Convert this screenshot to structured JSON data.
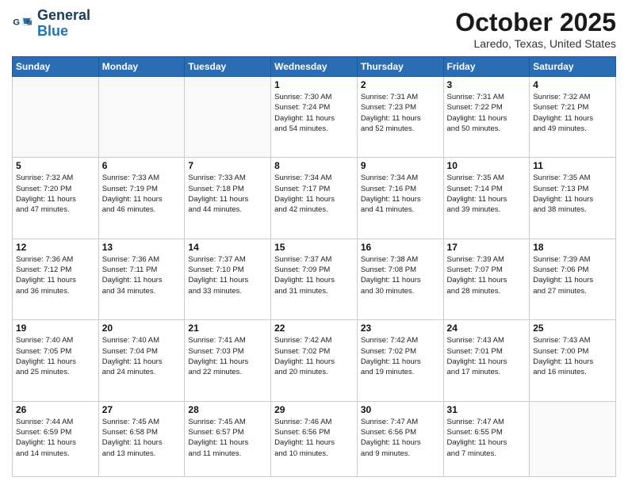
{
  "header": {
    "logo_line1": "General",
    "logo_line2": "Blue",
    "month": "October 2025",
    "location": "Laredo, Texas, United States"
  },
  "weekdays": [
    "Sunday",
    "Monday",
    "Tuesday",
    "Wednesday",
    "Thursday",
    "Friday",
    "Saturday"
  ],
  "weeks": [
    [
      {
        "day": "",
        "info": ""
      },
      {
        "day": "",
        "info": ""
      },
      {
        "day": "",
        "info": ""
      },
      {
        "day": "1",
        "info": "Sunrise: 7:30 AM\nSunset: 7:24 PM\nDaylight: 11 hours\nand 54 minutes."
      },
      {
        "day": "2",
        "info": "Sunrise: 7:31 AM\nSunset: 7:23 PM\nDaylight: 11 hours\nand 52 minutes."
      },
      {
        "day": "3",
        "info": "Sunrise: 7:31 AM\nSunset: 7:22 PM\nDaylight: 11 hours\nand 50 minutes."
      },
      {
        "day": "4",
        "info": "Sunrise: 7:32 AM\nSunset: 7:21 PM\nDaylight: 11 hours\nand 49 minutes."
      }
    ],
    [
      {
        "day": "5",
        "info": "Sunrise: 7:32 AM\nSunset: 7:20 PM\nDaylight: 11 hours\nand 47 minutes."
      },
      {
        "day": "6",
        "info": "Sunrise: 7:33 AM\nSunset: 7:19 PM\nDaylight: 11 hours\nand 46 minutes."
      },
      {
        "day": "7",
        "info": "Sunrise: 7:33 AM\nSunset: 7:18 PM\nDaylight: 11 hours\nand 44 minutes."
      },
      {
        "day": "8",
        "info": "Sunrise: 7:34 AM\nSunset: 7:17 PM\nDaylight: 11 hours\nand 42 minutes."
      },
      {
        "day": "9",
        "info": "Sunrise: 7:34 AM\nSunset: 7:16 PM\nDaylight: 11 hours\nand 41 minutes."
      },
      {
        "day": "10",
        "info": "Sunrise: 7:35 AM\nSunset: 7:14 PM\nDaylight: 11 hours\nand 39 minutes."
      },
      {
        "day": "11",
        "info": "Sunrise: 7:35 AM\nSunset: 7:13 PM\nDaylight: 11 hours\nand 38 minutes."
      }
    ],
    [
      {
        "day": "12",
        "info": "Sunrise: 7:36 AM\nSunset: 7:12 PM\nDaylight: 11 hours\nand 36 minutes."
      },
      {
        "day": "13",
        "info": "Sunrise: 7:36 AM\nSunset: 7:11 PM\nDaylight: 11 hours\nand 34 minutes."
      },
      {
        "day": "14",
        "info": "Sunrise: 7:37 AM\nSunset: 7:10 PM\nDaylight: 11 hours\nand 33 minutes."
      },
      {
        "day": "15",
        "info": "Sunrise: 7:37 AM\nSunset: 7:09 PM\nDaylight: 11 hours\nand 31 minutes."
      },
      {
        "day": "16",
        "info": "Sunrise: 7:38 AM\nSunset: 7:08 PM\nDaylight: 11 hours\nand 30 minutes."
      },
      {
        "day": "17",
        "info": "Sunrise: 7:39 AM\nSunset: 7:07 PM\nDaylight: 11 hours\nand 28 minutes."
      },
      {
        "day": "18",
        "info": "Sunrise: 7:39 AM\nSunset: 7:06 PM\nDaylight: 11 hours\nand 27 minutes."
      }
    ],
    [
      {
        "day": "19",
        "info": "Sunrise: 7:40 AM\nSunset: 7:05 PM\nDaylight: 11 hours\nand 25 minutes."
      },
      {
        "day": "20",
        "info": "Sunrise: 7:40 AM\nSunset: 7:04 PM\nDaylight: 11 hours\nand 24 minutes."
      },
      {
        "day": "21",
        "info": "Sunrise: 7:41 AM\nSunset: 7:03 PM\nDaylight: 11 hours\nand 22 minutes."
      },
      {
        "day": "22",
        "info": "Sunrise: 7:42 AM\nSunset: 7:02 PM\nDaylight: 11 hours\nand 20 minutes."
      },
      {
        "day": "23",
        "info": "Sunrise: 7:42 AM\nSunset: 7:02 PM\nDaylight: 11 hours\nand 19 minutes."
      },
      {
        "day": "24",
        "info": "Sunrise: 7:43 AM\nSunset: 7:01 PM\nDaylight: 11 hours\nand 17 minutes."
      },
      {
        "day": "25",
        "info": "Sunrise: 7:43 AM\nSunset: 7:00 PM\nDaylight: 11 hours\nand 16 minutes."
      }
    ],
    [
      {
        "day": "26",
        "info": "Sunrise: 7:44 AM\nSunset: 6:59 PM\nDaylight: 11 hours\nand 14 minutes."
      },
      {
        "day": "27",
        "info": "Sunrise: 7:45 AM\nSunset: 6:58 PM\nDaylight: 11 hours\nand 13 minutes."
      },
      {
        "day": "28",
        "info": "Sunrise: 7:45 AM\nSunset: 6:57 PM\nDaylight: 11 hours\nand 11 minutes."
      },
      {
        "day": "29",
        "info": "Sunrise: 7:46 AM\nSunset: 6:56 PM\nDaylight: 11 hours\nand 10 minutes."
      },
      {
        "day": "30",
        "info": "Sunrise: 7:47 AM\nSunset: 6:56 PM\nDaylight: 11 hours\nand 9 minutes."
      },
      {
        "day": "31",
        "info": "Sunrise: 7:47 AM\nSunset: 6:55 PM\nDaylight: 11 hours\nand 7 minutes."
      },
      {
        "day": "",
        "info": ""
      }
    ]
  ]
}
